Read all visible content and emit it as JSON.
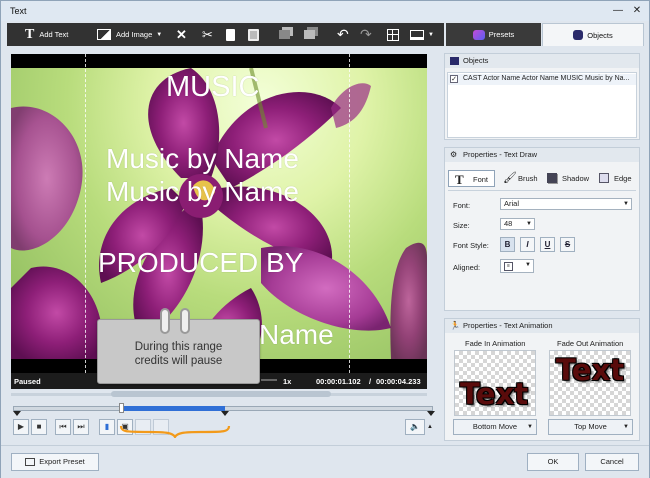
{
  "window": {
    "title": "Text",
    "minimize_icon": "minimize-icon",
    "close_icon": "close-icon"
  },
  "toolbar": {
    "add_text_label": "Add Text",
    "add_image_label": "Add Image",
    "icons": [
      "text-icon",
      "image-icon",
      "chevron-down-icon",
      "delete-icon",
      "cut-icon",
      "copy-icon",
      "paste-icon",
      "bring-forward-icon",
      "send-backward-icon",
      "undo-icon",
      "redo-icon",
      "grid-icon",
      "monitor-icon",
      "chevron-down-icon"
    ]
  },
  "tabs": {
    "presets_label": "Presets",
    "objects_label": "Objects",
    "active": "Objects"
  },
  "objects_panel": {
    "title": "Objects",
    "items": [
      {
        "checked": true,
        "label": "CAST  Actor Name Actor Name  MUSIC  Music by Na..."
      }
    ]
  },
  "text_draw_panel": {
    "title": "Properties - Text Draw",
    "tabs": [
      "Font",
      "Brush",
      "Shadow",
      "Edge"
    ],
    "active_tab": "Font",
    "font_label": "Font:",
    "font_value": "Arial",
    "size_label": "Size:",
    "size_value": "48",
    "style_label": "Font Style:",
    "style_buttons": [
      "B",
      "I",
      "U",
      "S"
    ],
    "aligned_label": "Aligned:"
  },
  "animation_panel": {
    "title": "Properties - Text Animation",
    "fade_in_label": "Fade In Animation",
    "fade_out_label": "Fade Out Animation",
    "preview_text": "Text",
    "fade_in_value": "Bottom Move",
    "fade_out_value": "Top Move"
  },
  "preview": {
    "credits_lines": [
      "MUSIC",
      "Music by Name",
      "Music by Name",
      "PRODUCED BY",
      "Name"
    ],
    "status": "Paused",
    "speed": "1x",
    "current_time": "00:00:01.102",
    "total_time": "00:00:04.233"
  },
  "tooltip": {
    "text_line1": "During this range",
    "text_line2": "credits will pause"
  },
  "footer": {
    "export_label": "Export Preset",
    "ok_label": "OK",
    "cancel_label": "Cancel"
  },
  "colors": {
    "accent": "#2f6fd6",
    "toolbar_bg": "#323232",
    "highlight": "#f29a1a"
  }
}
